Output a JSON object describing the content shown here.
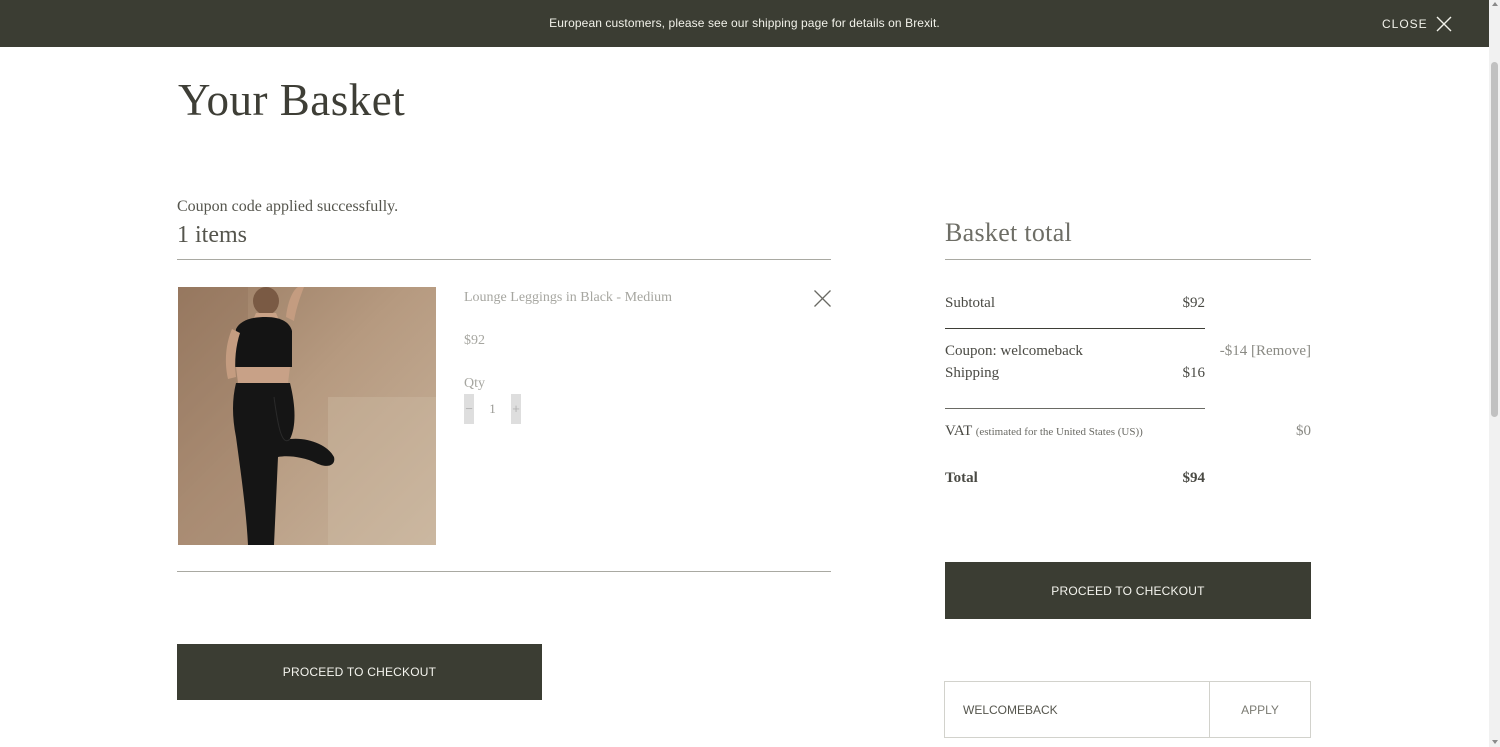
{
  "banner": {
    "message": "European customers, please see our shipping page for details on Brexit.",
    "close_label": "CLOSE",
    "background": "#3b3d33"
  },
  "page": {
    "title": "Your Basket",
    "coupon_message": "Coupon code applied successfully.",
    "items_count": "1 items"
  },
  "item": {
    "name": "Lounge Leggings in Black - Medium",
    "price": "$92",
    "qty_label": "Qty",
    "qty_minus": "−",
    "qty_plus": "+",
    "qty_value": "1"
  },
  "checkout": {
    "button_label": "PROCEED TO CHECKOUT",
    "button_color": "#3b3d33"
  },
  "totals": {
    "title": "Basket total",
    "subtotal_label": "Subtotal",
    "subtotal_value": "$92",
    "coupon_label": "Coupon: welcomeback",
    "coupon_value": "-$14 [Remove]",
    "shipping_label": "Shipping",
    "shipping_value": "$16",
    "vat_label": "VAT",
    "vat_note": "(estimated for the United States (US))",
    "vat_value": "$0",
    "total_label": "Total",
    "total_value": "$94"
  },
  "coupon_form": {
    "input_value": "WELCOMEBACK",
    "apply_label": "APPLY"
  }
}
